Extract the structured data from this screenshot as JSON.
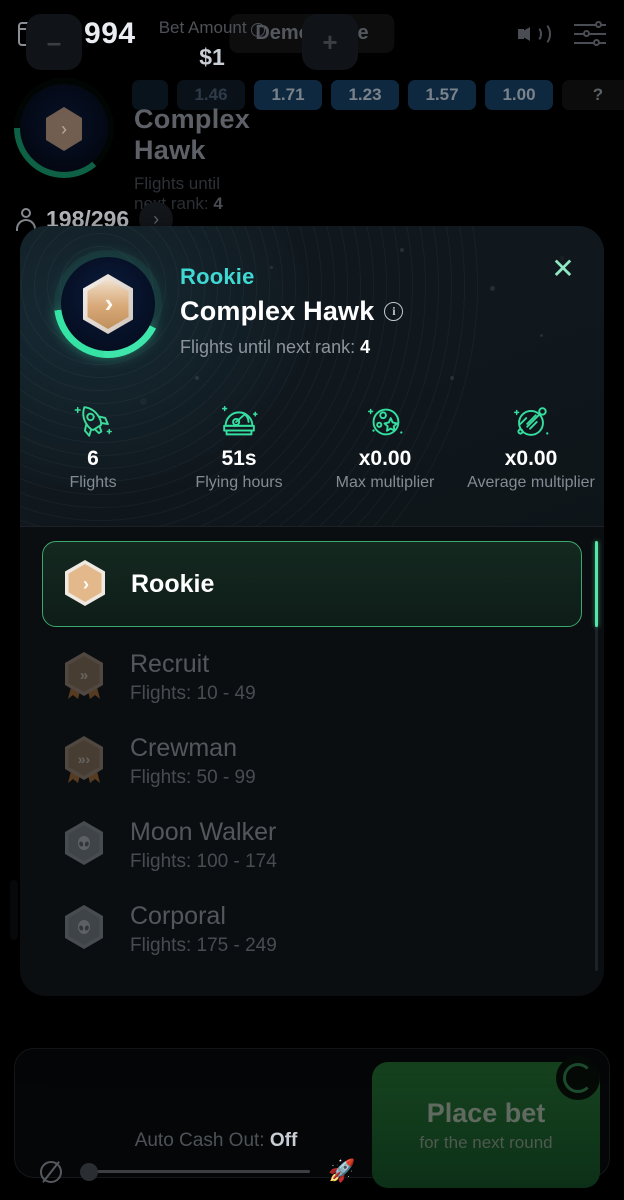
{
  "topbar": {
    "wallet_icon": "wallet-icon",
    "balance": "$ 994",
    "mode_label": "Demo Mode",
    "sound_icon": "sound-on-icon",
    "settings_icon": "settings-sliders-icon"
  },
  "history_chips": [
    {
      "label": "1.46",
      "style": "faded"
    },
    {
      "label": "1.71",
      "style": "blue"
    },
    {
      "label": "1.23",
      "style": "blue"
    },
    {
      "label": "1.57",
      "style": "blue"
    },
    {
      "label": "1.00",
      "style": "blue"
    },
    {
      "label": "?",
      "style": "q"
    }
  ],
  "background_rank": {
    "name": "Complex Hawk",
    "sub_prefix": "Flights until next rank:",
    "sub_value": "4"
  },
  "players": {
    "icon": "person-icon",
    "count": "198/296",
    "next_icon": "chevron-right-icon"
  },
  "modal": {
    "close_icon": "close-icon",
    "tier": "Rookie",
    "player_name": "Complex Hawk",
    "info_icon": "info-icon",
    "info_glyph": "i",
    "flights_label": "Flights until next rank:",
    "flights_value": "4",
    "stats": [
      {
        "icon": "rocket-icon",
        "value": "6",
        "label": "Flights"
      },
      {
        "icon": "space-helmet-icon",
        "value": "51s",
        "label": "Flying hours"
      },
      {
        "icon": "planet-star-icon",
        "value": "x0.00",
        "label": "Max\nmultiplier"
      },
      {
        "icon": "planet-comet-icon",
        "value": "x0.00",
        "label": "Average\nmultiplier"
      }
    ],
    "ranks": [
      {
        "name": "Rookie",
        "flights": "",
        "badge": "bronze-hex-chevron1",
        "active": true
      },
      {
        "name": "Recruit",
        "flights": "Flights: 10 - 49",
        "badge": "bronze-hex-chevron2",
        "active": false
      },
      {
        "name": "Crewman",
        "flights": "Flights: 50 - 99",
        "badge": "bronze-hex-chevron3",
        "active": false
      },
      {
        "name": "Moon Walker",
        "flights": "Flights: 100 - 174",
        "badge": "silver-hex-alien",
        "active": false
      },
      {
        "name": "Corporal",
        "flights": "Flights: 175 - 249",
        "badge": "silver-hex-alien",
        "active": false
      }
    ]
  },
  "bet_panel": {
    "minus_label": "–",
    "plus_label": "+",
    "bet_amount_label": "Bet Amount",
    "info_glyph": "i",
    "bet_amount_value": "$1",
    "auto_cashout_label": "Auto Cash Out:",
    "auto_cashout_value": "Off",
    "mute_icon": "mute-icon",
    "rocket_icon": "rocket-icon",
    "place_bet_title": "Place bet",
    "place_bet_sub": "for the next round",
    "refresh_icon": "refresh-icon"
  },
  "colors": {
    "accent_green": "#35e3a4",
    "accent_teal": "#3fd8d3",
    "bronze": "#d4a373",
    "chip_blue": "#0e2840",
    "modal_bg": "#0b0e11"
  }
}
